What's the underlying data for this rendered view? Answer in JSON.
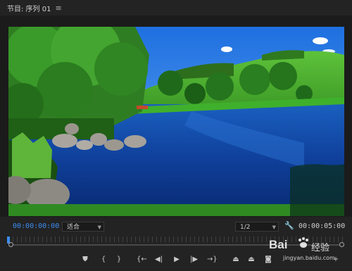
{
  "header": {
    "title": "节目: 序列 01",
    "menu_icon": "hamburger-menu-icon"
  },
  "controls": {
    "timecode_current": "00:00:00:00",
    "fit_option": "适合",
    "resolution": "1/2",
    "settings_icon": "wrench-icon",
    "timecode_duration": "00:00:05:00"
  },
  "transport": {
    "buttons": [
      {
        "name": "add-marker-button",
        "glyph": "⛊"
      },
      {
        "name": "mark-in-button",
        "glyph": "{"
      },
      {
        "name": "mark-out-button",
        "glyph": "}"
      },
      {
        "name": "go-to-in-button",
        "glyph": "{←"
      },
      {
        "name": "step-back-button",
        "glyph": "◀|"
      },
      {
        "name": "play-button",
        "glyph": "▶"
      },
      {
        "name": "step-forward-button",
        "glyph": "|▶"
      },
      {
        "name": "go-to-out-button",
        "glyph": "→}"
      },
      {
        "name": "lift-button",
        "glyph": "⏏"
      },
      {
        "name": "extract-button",
        "glyph": "⏏"
      },
      {
        "name": "export-frame-button",
        "glyph": "📷"
      },
      {
        "name": "button-editor-button",
        "glyph": "+"
      }
    ]
  },
  "watermark": {
    "brand": "Bai",
    "brand_suffix": "经验",
    "url": "jingyan.baidu.com"
  },
  "colors": {
    "accent": "#3c8cf0",
    "panel_bg": "#232323"
  }
}
